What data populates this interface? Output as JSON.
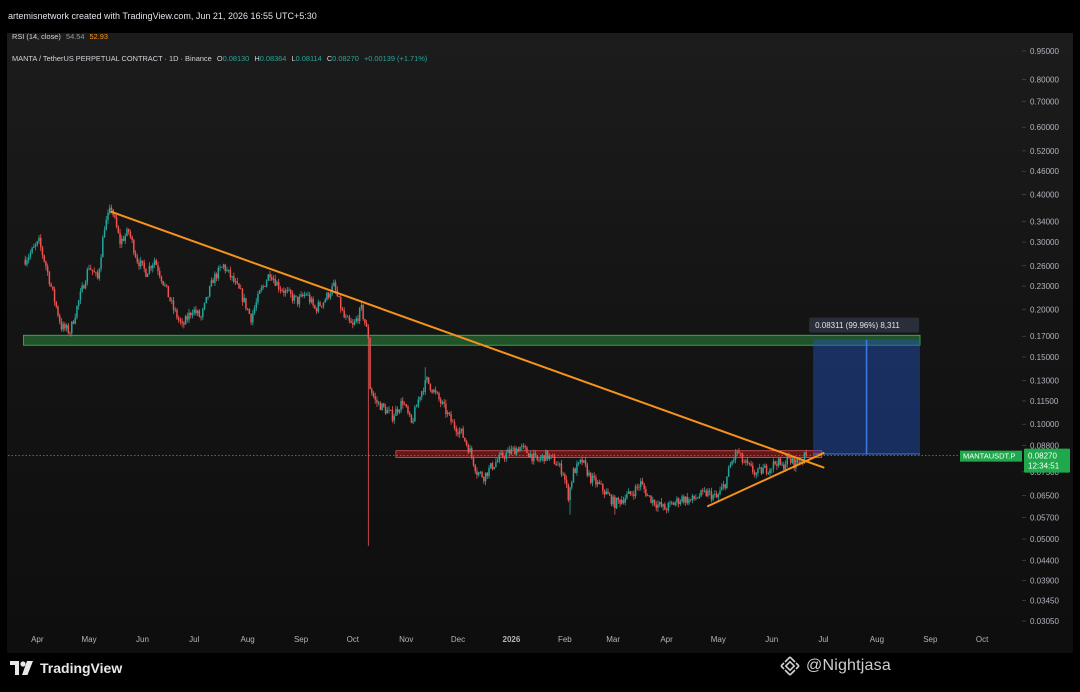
{
  "header": {
    "credit": "artemisnetwork created with TradingView.com, Jun 21, 2026 16:55 UTC+5:30",
    "rsi_label": "RSI (14, close)",
    "rsi_value_1": "54.54",
    "rsi_value_2": "52.93",
    "symbol": "MANTA / TetherUS PERPETUAL CONTRACT · 1D · Binance",
    "open_label": "O",
    "open_value": "0.08130",
    "high_label": "H",
    "high_value": "0.08364",
    "low_label": "L",
    "low_value": "0.08114",
    "close_label": "C",
    "close_value": "0.08270",
    "change": "+0.00139 (+1.71%)"
  },
  "footer": {
    "brand": "TradingView",
    "watermark": "@Nightjasa"
  },
  "colors": {
    "background": "#000000",
    "up": "#26a69a",
    "down": "#ef5350",
    "trendline": "#f7931a",
    "support_zone": "#1e7a2e",
    "resistance_zone": "#b71c1c",
    "projection": "#1e3a7a",
    "price_tag": "#1fa84c"
  },
  "chart_data": {
    "type": "candlestick",
    "y_scale": "log",
    "ylim": [
      0.0285,
      1.04
    ],
    "x_ticks": [
      "Apr",
      "May",
      "Jun",
      "Jul",
      "Aug",
      "Sep",
      "Oct",
      "Nov",
      "Dec",
      "2026",
      "Feb",
      "Mar",
      "Apr",
      "May",
      "Jun",
      "Jul",
      "Aug",
      "Sep",
      "Oct"
    ],
    "y_ticks": [
      "0.95000",
      "0.80000",
      "0.70000",
      "0.60000",
      "0.52000",
      "0.46000",
      "0.40000",
      "0.34000",
      "0.30000",
      "0.26000",
      "0.23000",
      "0.20000",
      "0.17000",
      "0.15000",
      "0.13000",
      "0.11500",
      "0.10000",
      "0.08800",
      "0.07500",
      "0.06500",
      "0.05700",
      "0.05000",
      "0.04400",
      "0.03900",
      "0.03450",
      "0.03050"
    ],
    "price_anchors": [
      [
        "2025-03-25",
        0.27
      ],
      [
        "2025-04-02",
        0.3
      ],
      [
        "2025-04-06",
        0.26
      ],
      [
        "2025-04-10",
        0.22
      ],
      [
        "2025-04-15",
        0.18
      ],
      [
        "2025-04-20",
        0.175
      ],
      [
        "2025-04-25",
        0.21
      ],
      [
        "2025-05-01",
        0.26
      ],
      [
        "2025-05-06",
        0.24
      ],
      [
        "2025-05-10",
        0.33
      ],
      [
        "2025-05-14",
        0.37
      ],
      [
        "2025-05-19",
        0.3
      ],
      [
        "2025-05-24",
        0.32
      ],
      [
        "2025-05-29",
        0.27
      ],
      [
        "2025-06-03",
        0.25
      ],
      [
        "2025-06-08",
        0.27
      ],
      [
        "2025-06-14",
        0.23
      ],
      [
        "2025-06-19",
        0.2
      ],
      [
        "2025-06-24",
        0.18
      ],
      [
        "2025-06-30",
        0.2
      ],
      [
        "2025-07-05",
        0.19
      ],
      [
        "2025-07-12",
        0.24
      ],
      [
        "2025-07-18",
        0.26
      ],
      [
        "2025-07-23",
        0.24
      ],
      [
        "2025-07-28",
        0.22
      ],
      [
        "2025-08-03",
        0.19
      ],
      [
        "2025-08-08",
        0.22
      ],
      [
        "2025-08-14",
        0.25
      ],
      [
        "2025-08-19",
        0.23
      ],
      [
        "2025-08-24",
        0.22
      ],
      [
        "2025-08-30",
        0.21
      ],
      [
        "2025-09-04",
        0.22
      ],
      [
        "2025-09-09",
        0.2
      ],
      [
        "2025-09-14",
        0.21
      ],
      [
        "2025-09-20",
        0.23
      ],
      [
        "2025-09-26",
        0.19
      ],
      [
        "2025-10-01",
        0.18
      ],
      [
        "2025-10-06",
        0.2
      ],
      [
        "2025-10-10",
        0.17
      ],
      [
        "2025-10-11",
        0.125
      ],
      [
        "2025-10-14",
        0.115
      ],
      [
        "2025-10-19",
        0.11
      ],
      [
        "2025-10-24",
        0.105
      ],
      [
        "2025-10-30",
        0.115
      ],
      [
        "2025-11-04",
        0.1
      ],
      [
        "2025-11-09",
        0.12
      ],
      [
        "2025-11-13",
        0.13
      ],
      [
        "2025-11-18",
        0.12
      ],
      [
        "2025-11-23",
        0.11
      ],
      [
        "2025-11-28",
        0.1
      ],
      [
        "2025-12-03",
        0.095
      ],
      [
        "2025-12-08",
        0.085
      ],
      [
        "2025-12-12",
        0.075
      ],
      [
        "2025-12-16",
        0.073
      ],
      [
        "2025-12-20",
        0.077
      ],
      [
        "2025-12-26",
        0.082
      ],
      [
        "2026-01-01",
        0.085
      ],
      [
        "2026-01-06",
        0.087
      ],
      [
        "2026-01-11",
        0.084
      ],
      [
        "2026-01-16",
        0.08
      ],
      [
        "2026-01-21",
        0.083
      ],
      [
        "2026-01-26",
        0.08
      ],
      [
        "2026-01-31",
        0.075
      ],
      [
        "2026-02-03",
        0.065
      ],
      [
        "2026-02-06",
        0.075
      ],
      [
        "2026-02-11",
        0.08
      ],
      [
        "2026-02-16",
        0.072
      ],
      [
        "2026-02-21",
        0.069
      ],
      [
        "2026-02-26",
        0.065
      ],
      [
        "2026-03-02",
        0.062
      ],
      [
        "2026-03-07",
        0.064
      ],
      [
        "2026-03-12",
        0.066
      ],
      [
        "2026-03-17",
        0.07
      ],
      [
        "2026-03-21",
        0.065
      ],
      [
        "2026-03-26",
        0.062
      ],
      [
        "2026-03-31",
        0.06
      ],
      [
        "2026-04-05",
        0.062
      ],
      [
        "2026-04-10",
        0.064
      ],
      [
        "2026-04-15",
        0.063
      ],
      [
        "2026-04-20",
        0.065
      ],
      [
        "2026-04-25",
        0.066
      ],
      [
        "2026-04-30",
        0.064
      ],
      [
        "2026-05-05",
        0.07
      ],
      [
        "2026-05-08",
        0.078
      ],
      [
        "2026-05-12",
        0.085
      ],
      [
        "2026-05-15",
        0.08
      ],
      [
        "2026-05-19",
        0.077
      ],
      [
        "2026-05-23",
        0.074
      ],
      [
        "2026-05-27",
        0.076
      ],
      [
        "2026-05-31",
        0.077
      ],
      [
        "2026-06-04",
        0.08
      ],
      [
        "2026-06-07",
        0.077
      ],
      [
        "2026-06-10",
        0.081
      ],
      [
        "2026-06-14",
        0.079
      ],
      [
        "2026-06-17",
        0.08
      ],
      [
        "2026-06-21",
        0.0827
      ]
    ],
    "wicks": [
      [
        "2025-10-10",
        0.048
      ],
      [
        "2025-11-12",
        0.141
      ],
      [
        "2026-02-04",
        0.058
      ],
      [
        "2026-03-02",
        0.058
      ],
      [
        "2026-05-11",
        0.086
      ]
    ],
    "trendlines": [
      {
        "name": "descending-resistance",
        "from": [
          "2025-05-14",
          0.36
        ],
        "to": [
          "2026-07-01",
          0.077
        ]
      },
      {
        "name": "ascending-support",
        "from": [
          "2026-04-25",
          0.061
        ],
        "to": [
          "2026-07-01",
          0.084
        ]
      }
    ],
    "zones": [
      {
        "name": "support-zone",
        "from": "2025-03-24",
        "to": "2026-08-26",
        "low": 0.161,
        "high": 0.171
      },
      {
        "name": "resistance-zone",
        "from": "2025-10-26",
        "to": "2026-06-30",
        "low": 0.0818,
        "high": 0.0852
      }
    ],
    "projection": {
      "from": "2026-06-25",
      "to": "2026-08-26",
      "low": 0.0835,
      "high": 0.1665,
      "label": "0.08311 (99.96%) 8,311"
    },
    "current_price": {
      "value": 0.0827,
      "symbol_label": "MANTAUSDT.P",
      "price_label": "0.08270",
      "countdown": "12:34:51"
    }
  }
}
